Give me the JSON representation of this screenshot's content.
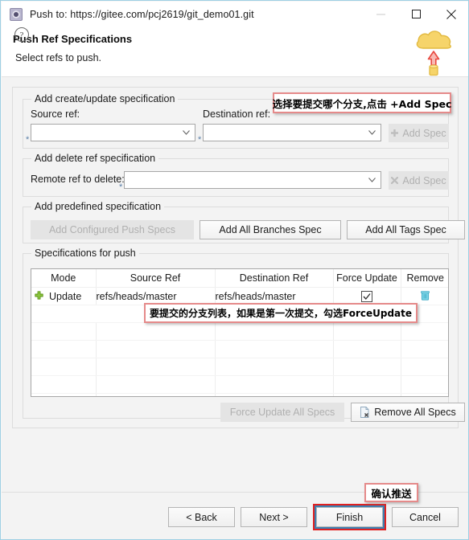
{
  "window": {
    "title": "Push to: https://gitee.com/pcj2619/git_demo01.git",
    "app_icon": "eclipse-gear-icon",
    "controls": {
      "minimize": "minimize-icon",
      "maximize": "maximize-icon",
      "close": "close-icon"
    }
  },
  "header": {
    "title": "Push Ref Specifications",
    "subtitle": "Select refs to push.",
    "banner_icon": "cloud-push-icon"
  },
  "create_update_group": {
    "title": "Add create/update specification",
    "source_label": "Source ref:",
    "source_value": "",
    "destination_label": "Destination ref:",
    "destination_value": "",
    "add_spec_label": "Add Spec",
    "add_spec_icon": "plus-icon",
    "add_spec_enabled": false
  },
  "delete_group": {
    "title": "Add delete ref specification",
    "remote_label": "Remote ref to delete:",
    "remote_value": "",
    "add_spec_label": "Add Spec",
    "add_spec_icon": "x-mark-icon",
    "add_spec_enabled": false
  },
  "predefined_group": {
    "title": "Add predefined specification",
    "buttons": [
      {
        "label": "Add Configured Push Specs",
        "enabled": false
      },
      {
        "label": "Add All Branches Spec",
        "enabled": true
      },
      {
        "label": "Add All Tags Spec",
        "enabled": true
      }
    ]
  },
  "specifications_group": {
    "title": "Specifications for push",
    "columns": [
      "Mode",
      "Source Ref",
      "Destination Ref",
      "Force Update",
      "Remove"
    ],
    "rows": [
      {
        "mode_icon": "green-plus-icon",
        "mode": "Update",
        "source_ref": "refs/heads/master",
        "destination_ref": "refs/heads/master",
        "force_update": true,
        "remove_icon": "trash-icon"
      }
    ],
    "empty_row_count": 7,
    "force_update_all_label": "Force Update All Specs",
    "force_update_all_enabled": false,
    "remove_all_label": "Remove All Specs",
    "remove_all_icon": "remove-document-icon",
    "remove_all_enabled": true
  },
  "footer": {
    "help_icon": "help-question-icon",
    "buttons": [
      {
        "label": "< Back",
        "name": "back-button",
        "highlighted": false
      },
      {
        "label": "Next >",
        "name": "next-button",
        "highlighted": false
      },
      {
        "label": "Finish",
        "name": "finish-button",
        "highlighted": true
      },
      {
        "label": "Cancel",
        "name": "cancel-button",
        "highlighted": false
      }
    ]
  },
  "annotations": [
    {
      "text": "选择要提交哪个分支,点击 +Add Spec",
      "name": "annotation-select-branch"
    },
    {
      "text": "要提交的分支列表，如果是第一次提交，勾选ForceUpdate",
      "name": "annotation-branch-list"
    },
    {
      "text": "确认推送",
      "name": "annotation-confirm-push"
    }
  ],
  "colors": {
    "annotation_border": "#e58a8a",
    "highlight_border": "#e02020",
    "focus_border": "#3c7fb1",
    "cloud": "#f4cf5f",
    "arrow": "#e8483f",
    "plus_green": "#73b83c",
    "trash_teal": "#4fc3d9"
  }
}
